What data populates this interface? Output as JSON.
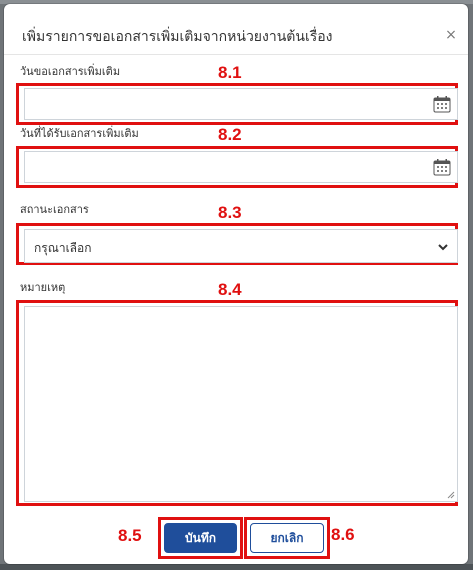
{
  "modal": {
    "title": "เพิ่มรายการขอเอกสารเพิ่มเติมจากหน่วยงานต้นเรื่อง",
    "close_symbol": "×"
  },
  "fields": {
    "request_date_label": "วันขอเอกสารเพิ่มเติม",
    "receive_date_label": "วันที่ได้รับเอกสารเพิ่มเติม",
    "status_label": "สถานะเอกสาร",
    "status_selected": "กรุณาเลือก",
    "note_label": "หมายเหตุ"
  },
  "buttons": {
    "save": "บันทึก",
    "cancel": "ยกเลิก"
  },
  "steps": {
    "s1": "8.1",
    "s2": "8.2",
    "s3": "8.3",
    "s4": "8.4",
    "s5": "8.5",
    "s6": "8.6"
  },
  "colors": {
    "primary": "#1f4e9b",
    "highlight": "#e01010",
    "text": "#333333"
  },
  "icons": [
    "calendar-icon",
    "chevron-down-icon",
    "close-icon",
    "resize-grip-icon"
  ]
}
